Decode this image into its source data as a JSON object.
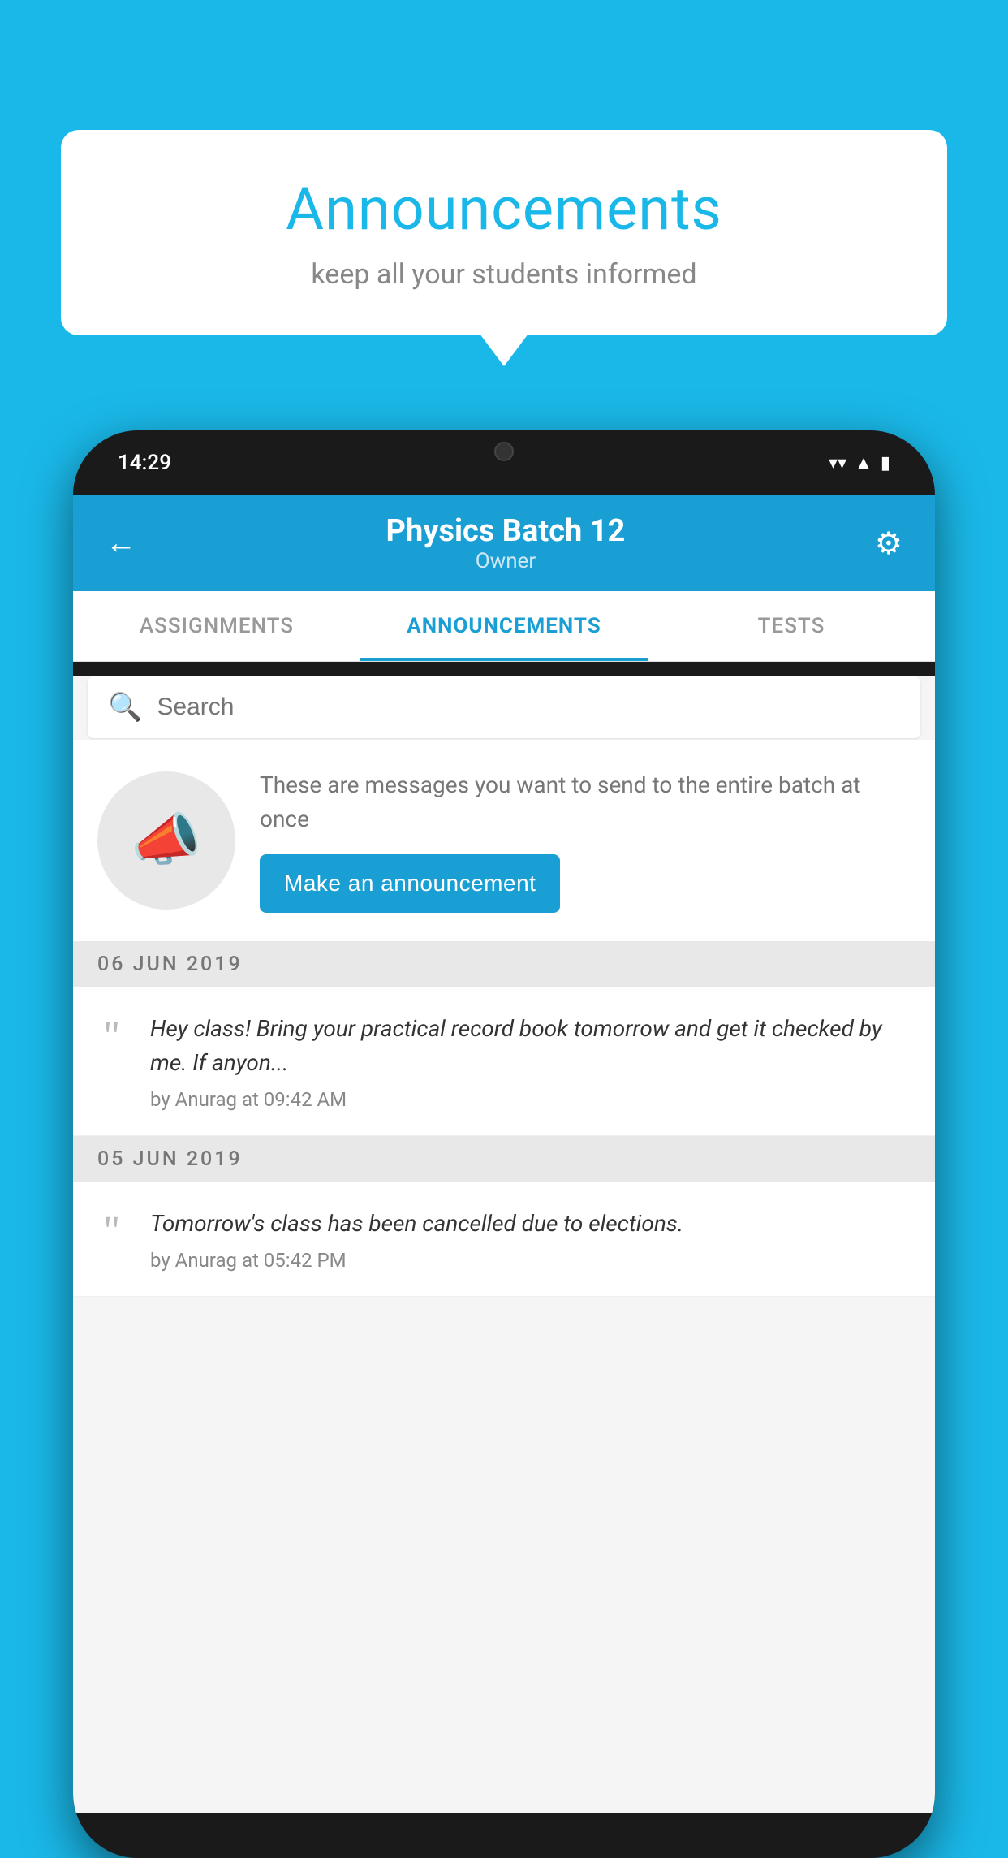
{
  "background_color": "#1ab8e8",
  "speech_bubble": {
    "title": "Announcements",
    "subtitle": "keep all your students informed"
  },
  "phone": {
    "status_bar": {
      "time": "14:29",
      "wifi": "▼",
      "signal": "▲",
      "battery": "▮"
    },
    "header": {
      "title": "Physics Batch 12",
      "subtitle": "Owner",
      "back_label": "←",
      "gear_label": "⚙"
    },
    "tabs": [
      {
        "label": "ASSIGNMENTS",
        "active": false
      },
      {
        "label": "ANNOUNCEMENTS",
        "active": true
      },
      {
        "label": "TESTS",
        "active": false
      }
    ],
    "search": {
      "placeholder": "Search"
    },
    "promo": {
      "text": "These are messages you want to send to the entire batch at once",
      "button_label": "Make an announcement"
    },
    "date_sections": [
      {
        "date": "06  JUN  2019",
        "announcements": [
          {
            "text": "Hey class! Bring your practical record book tomorrow and get it checked by me. If anyon...",
            "author": "by Anurag at 09:42 AM"
          }
        ]
      },
      {
        "date": "05  JUN  2019",
        "announcements": [
          {
            "text": "Tomorrow's class has been cancelled due to elections.",
            "author": "by Anurag at 05:42 PM"
          }
        ]
      }
    ]
  }
}
